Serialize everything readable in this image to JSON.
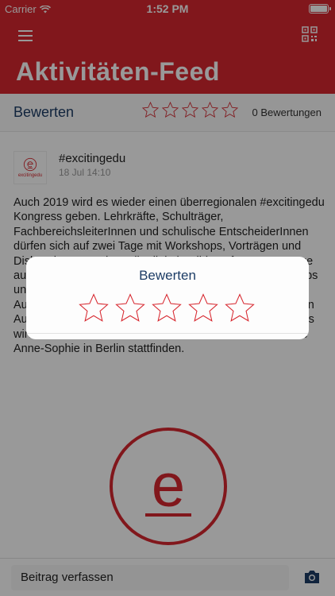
{
  "status_bar": {
    "carrier": "Carrier",
    "time": "1:52 PM"
  },
  "nav": {
    "title": "Aktivitäten-Feed",
    "menu_icon": "hamburger-menu-icon",
    "qr_icon": "qr-code-icon"
  },
  "rating": {
    "label": "Bewerten",
    "count_text": "0 Bewertungen",
    "stars_total": 5,
    "value": 0
  },
  "post": {
    "author": "#excitingedu",
    "date": "18 Jul 14:10",
    "avatar_text": "excitingedu",
    "body": "Auch 2019 wird es wieder einen überregionalen #excitingedu Kongress geben. Lehrkräfte, Schulträger, FachbereichsleiterInnen und schulische EntscheiderInnen dürfen sich auf zwei Tage mit Workshops, Vorträgen und Diskussionen rund um die digitale Bildung freuen. Vorträge aus der Forschung und Praxis, viele spannende Workshops und vielfältige Möglichkeiten zum Netzwerken laden ein. Aussteller präsentieren ihre Angebote, Raum für intensiven Austausch in einer anregenden Atmosphäre. Der Kongress wird voraussichtlich Mitte November an der Freien Schule Anne-Sophie in Berlin stattfinden.",
    "logo_letter": "e"
  },
  "compose": {
    "placeholder": "Beitrag verfassen",
    "camera_icon": "camera-icon"
  },
  "dialog": {
    "title": "Bewerten",
    "stars_total": 5,
    "value": 0
  },
  "colors": {
    "brand": "#d7272f",
    "title_blue": "#1d3d66"
  }
}
